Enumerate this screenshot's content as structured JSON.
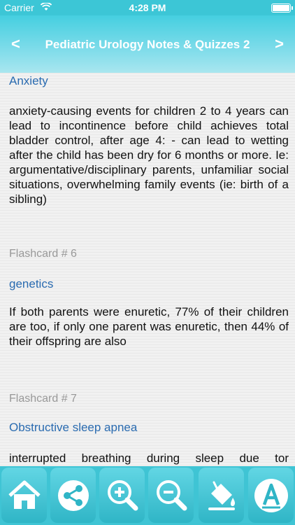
{
  "status": {
    "carrier": "Carrier",
    "time": "4:28 PM"
  },
  "header": {
    "title": "Pediatric Urology Notes & Quizzes 2",
    "prev": "<",
    "next": ">"
  },
  "entries": [
    {
      "topic": "Anxiety",
      "text": "anxiety-causing events for children 2 to 4 years can lead to incontinence before child achieves total bladder control, after age 4: - can lead to wetting after the child has been dry for 6 months or more. Ie: argumentative/disciplinary parents, unfamiliar social situations, overwhelming family events (ie: birth of a sibling)"
    },
    {
      "card": "Flashcard # 6",
      "topic": "genetics",
      "text": "If both parents were enuretic, 77% of their children are too, if only one parent was enuretic, then 44% of their offspring are also"
    },
    {
      "card": "Flashcard # 7",
      "topic": "Obstructive sleep apnea",
      "text": "interrupted breathing during sleep due tor"
    }
  ],
  "toolbar": [
    "home-icon",
    "share-icon",
    "zoom-in-icon",
    "zoom-out-icon",
    "paint-bucket-icon",
    "font-icon"
  ]
}
